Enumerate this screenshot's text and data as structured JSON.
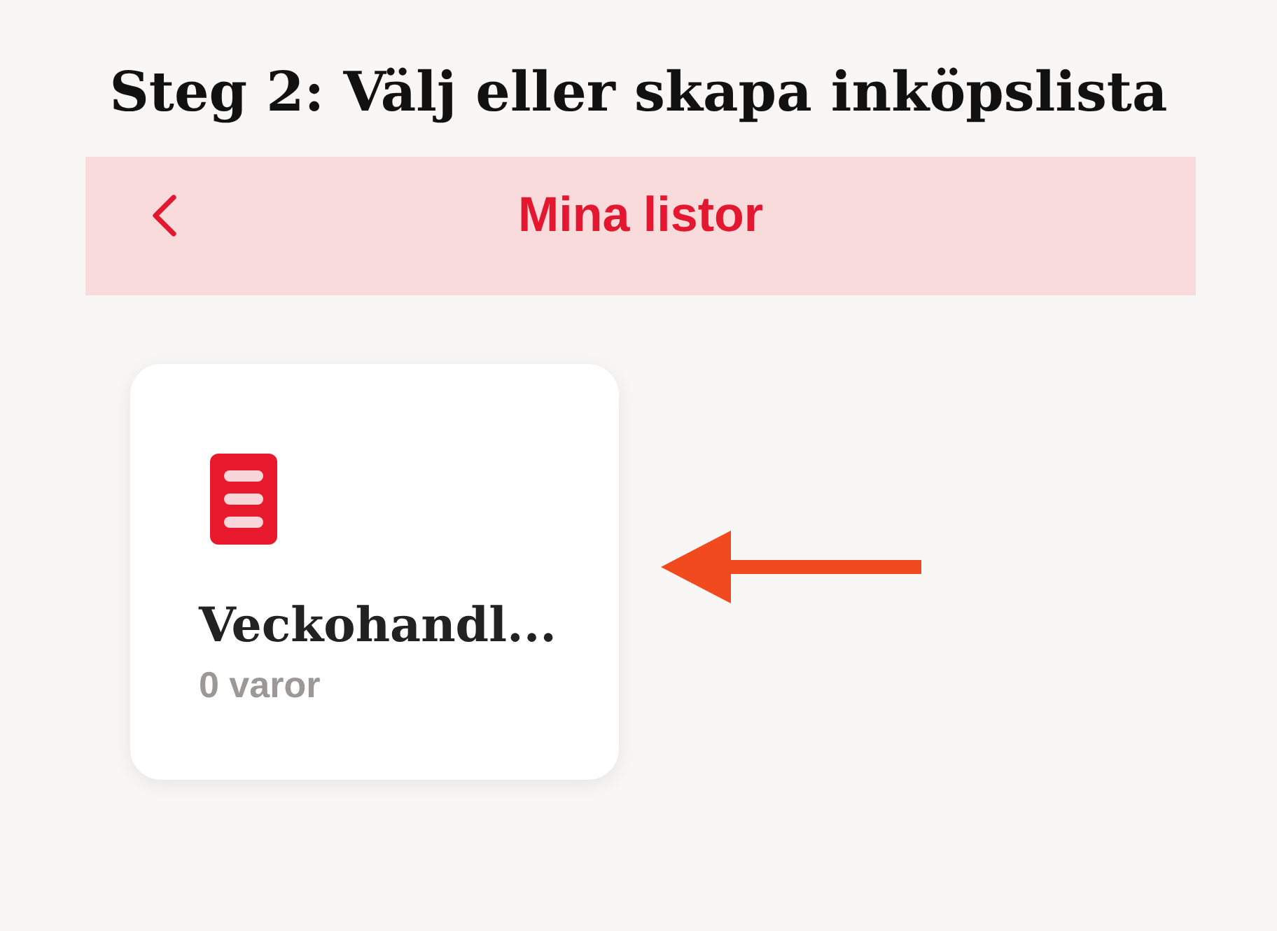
{
  "page_title": "Steg 2: Välj eller skapa inköpslista",
  "header": {
    "title": "Mina listor"
  },
  "lists": [
    {
      "name": "Veckohandl...",
      "count": "0 varor"
    }
  ]
}
